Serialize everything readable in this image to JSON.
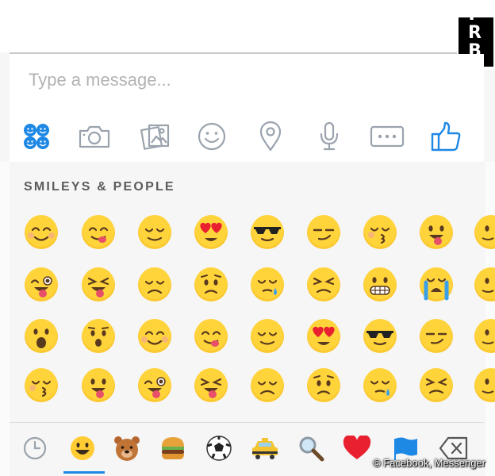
{
  "watermark": {
    "text": "PRBK"
  },
  "composer": {
    "placeholder": "Type a message..."
  },
  "toolbar": {
    "icons": [
      "stickers-icon",
      "camera-icon",
      "gallery-icon",
      "smiley-icon",
      "location-icon",
      "microphone-icon",
      "more-icon",
      "thumbs-up-icon"
    ],
    "accent_color": "#1e88e5",
    "icon_color": "#9aa3ad"
  },
  "emoji_panel": {
    "category_label": "SMILEYS & PEOPLE",
    "emoji_names": [
      [
        "smiling-blushing",
        "tongue-out-yum",
        "relieved",
        "heart-eyes",
        "cool-sunglasses",
        "smirk",
        "kissing",
        "tongue-out",
        "partial-face"
      ],
      [
        "wink-tongue",
        "squint-tongue",
        "disappointed",
        "worried",
        "sleepy-tear",
        "persevering",
        "grimacing",
        "loudly-crying",
        "partial-face"
      ],
      [
        "surprised-open-mouth",
        "hushed",
        "smiling-blushing",
        "tongue-out-yum",
        "relieved",
        "heart-eyes",
        "cool-sunglasses",
        "smirk",
        "partial-face"
      ],
      [
        "kissing",
        "tongue-out",
        "wink-tongue",
        "squint-tongue",
        "disappointed",
        "worried",
        "sleepy-tear",
        "persevering",
        "partial-face"
      ]
    ]
  },
  "category_tabs": [
    "recent-icon",
    "smileys-icon",
    "animals-bear-icon",
    "food-burger-icon",
    "activity-soccer-icon",
    "travel-taxi-icon",
    "objects-magnifier-icon",
    "symbols-heart-icon",
    "flags-icon",
    "backspace-icon"
  ],
  "selected_tab": "smileys-icon",
  "credit": "© Facebook, Messenger"
}
